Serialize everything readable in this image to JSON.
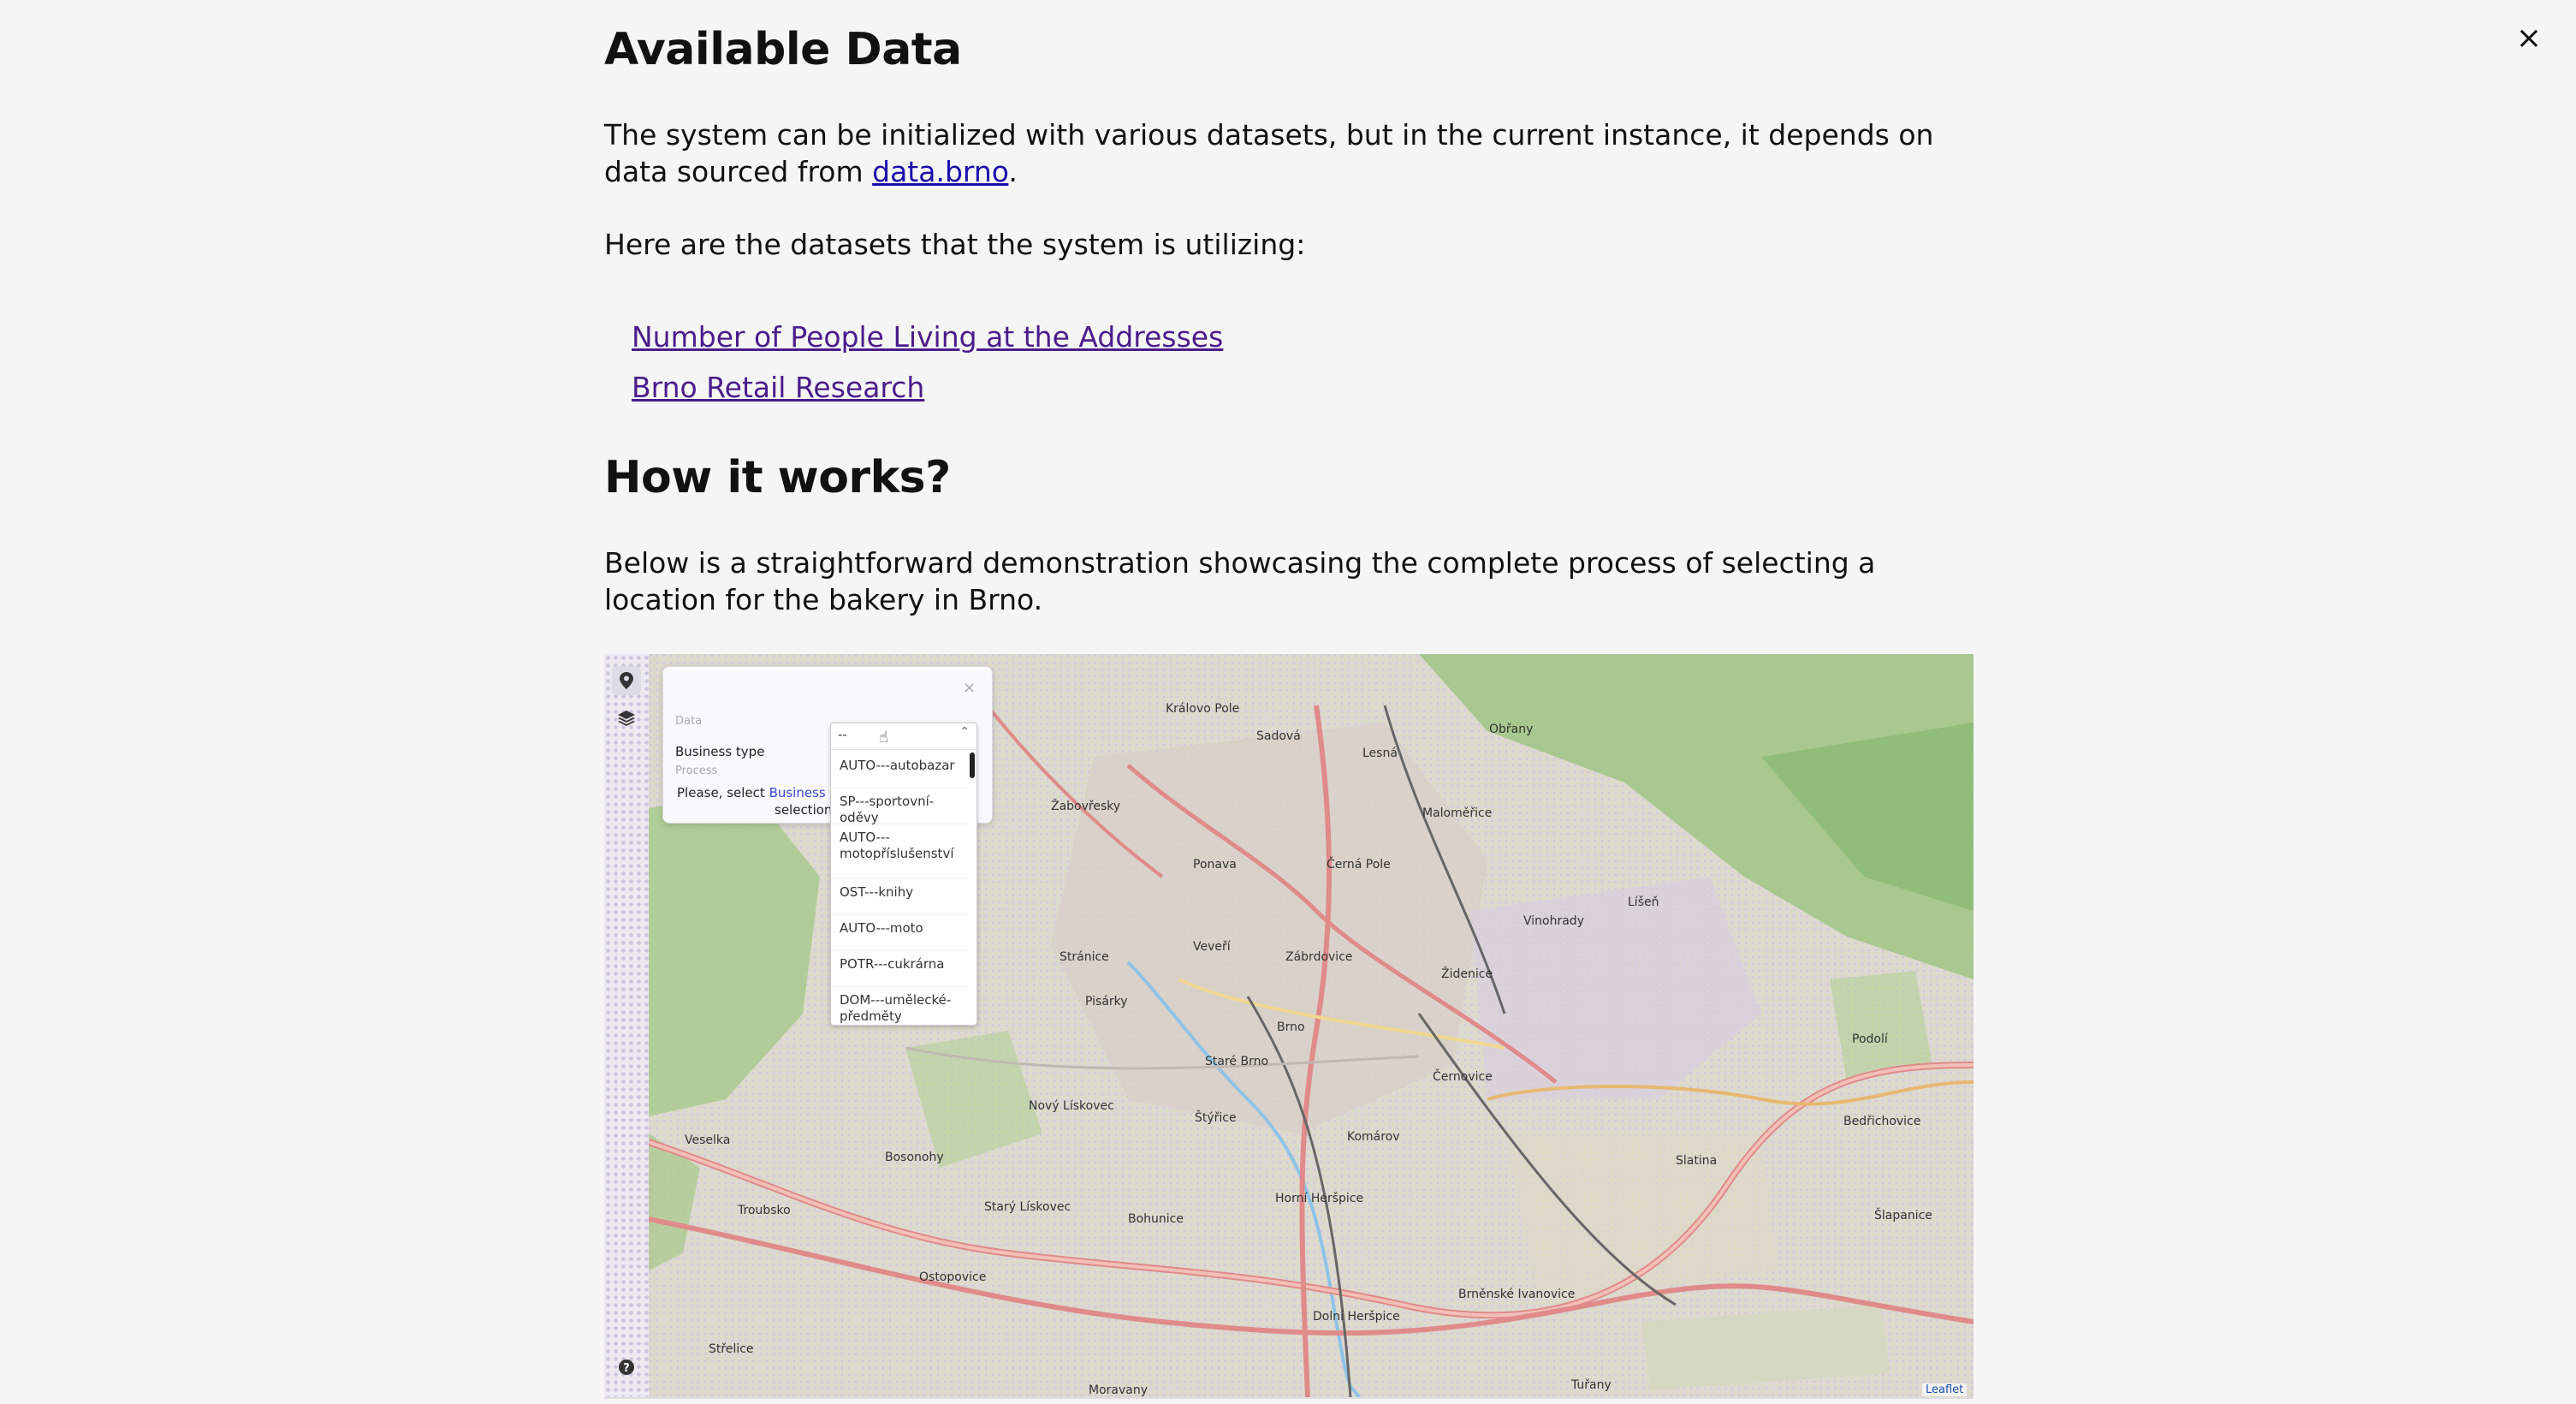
{
  "modal": {
    "close_icon": "×"
  },
  "available": {
    "title": "Available Data",
    "intro_before": "The system can be initialized with various datasets, but in the current instance, it depends on data sourced from ",
    "intro_link": "data.brno",
    "intro_after": ".",
    "datasets_intro": "Here are the datasets that the system is utilizing:",
    "datasets": [
      "Number of People Living at the Addresses",
      "Brno Retail Research"
    ]
  },
  "how": {
    "title": "How it works?",
    "description": "Below is a straightforward demonstration showcasing the complete process of selecting a location for the bakery in Brno."
  },
  "demo": {
    "popup": {
      "data_label": "Data",
      "field_label": "Business type",
      "process_label": "Process",
      "hint_before": "Please, select ",
      "hint_link": "Business typ",
      "hint_after": "selection p",
      "close_icon": "×"
    },
    "dropdown": {
      "value": "--",
      "options": [
        "AUTO---autobazar",
        "SP---sportovní-oděvy",
        "AUTO---motopříslušenství",
        "OST---knihy",
        "AUTO---moto",
        "POTR---cukrárna",
        "DOM---umělecké-předměty"
      ]
    },
    "zoom_in": "+",
    "zoom_out": "−",
    "attribution": "Leaflet",
    "map_labels": [
      "Královo Pole",
      "Sadová",
      "Lesná",
      "Obřany",
      "Žabovřesky",
      "Maloměřice",
      "Ponava",
      "Černá Pole",
      "Vinohrady",
      "Líšeň",
      "Stránice",
      "Veveří",
      "Zábrdovice",
      "Židenice",
      "Pisárky",
      "Brno",
      "Staré Brno",
      "Nový Lískovec",
      "Štýřice",
      "Černovice",
      "Komárov",
      "Bosonohy",
      "Bohunice",
      "Starý Lískovec",
      "Horní Heršpice",
      "Slatina",
      "Bedřichovice",
      "Šlapanice",
      "Veselka",
      "Troubsko",
      "Ostopovice",
      "Dolní Heršpice",
      "Brněnské Ivanovice",
      "Střelice",
      "Podolí",
      "Tuřany",
      "Moravany"
    ]
  }
}
